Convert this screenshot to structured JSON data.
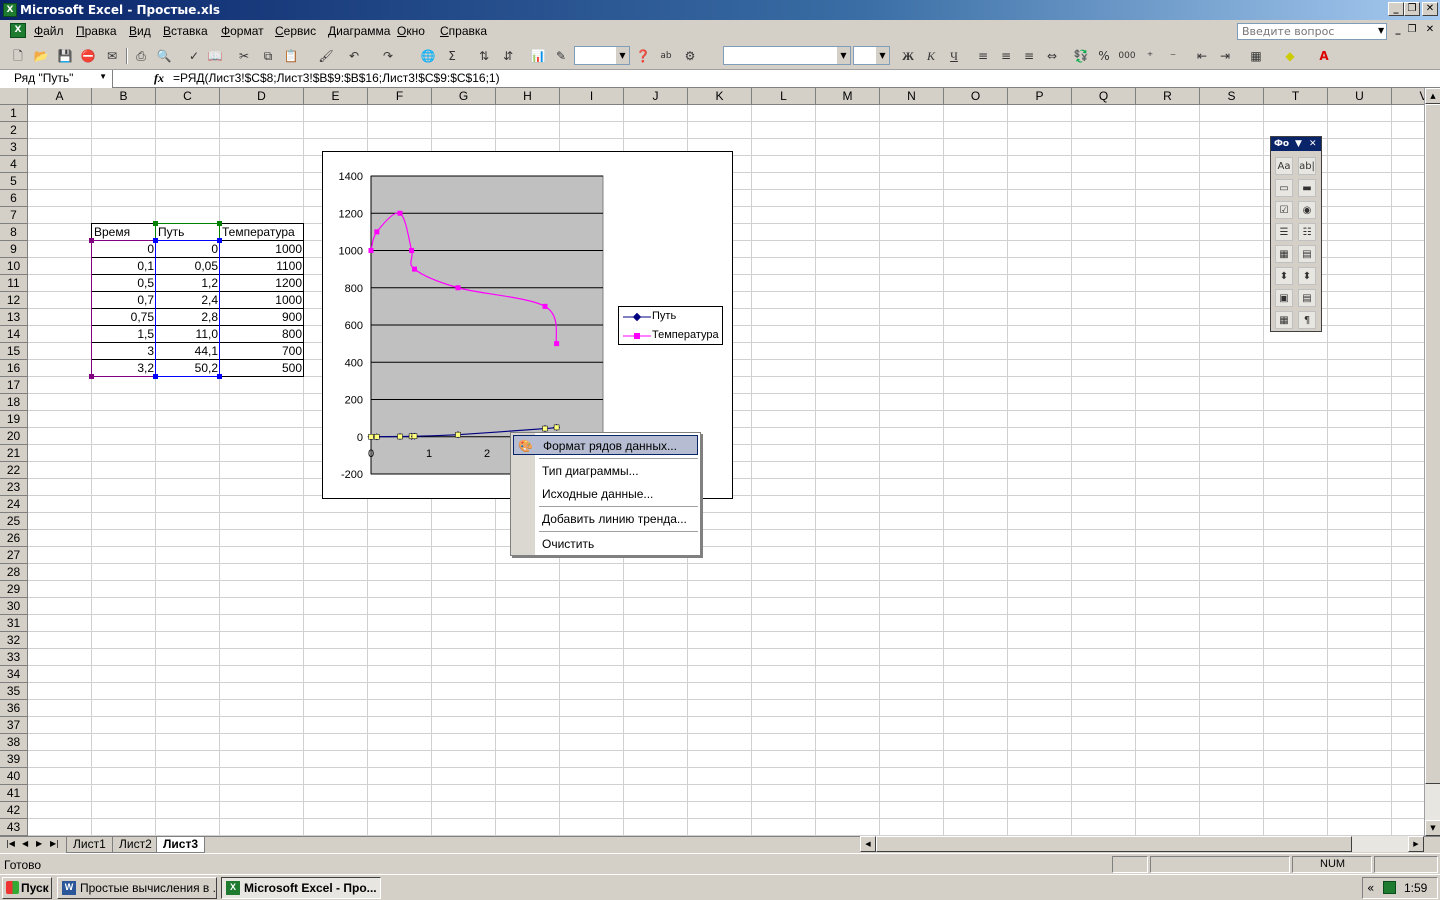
{
  "window": {
    "title": "Microsoft Excel - Простые.xls",
    "app_icon": "excel-icon",
    "controls": [
      "_",
      "❐",
      "✕"
    ],
    "doc_controls": [
      "_",
      "❐",
      "✕"
    ]
  },
  "menu": [
    "Файл",
    "Правка",
    "Вид",
    "Вставка",
    "Формат",
    "Сервис",
    "Диаграмма",
    "Окно",
    "Справка"
  ],
  "ask": {
    "placeholder": "Введите вопрос"
  },
  "formula_bar": {
    "name_box": "Ряд \"Путь\"",
    "fx": "fx",
    "formula": "=РЯД(Лист3!$C$8;Лист3!$B$9:$B$16;Лист3!$C$9:$C$16;1)"
  },
  "toolbar": {
    "fmt_bold": "Ж",
    "fmt_italic": "К",
    "fmt_underline": "Ч",
    "percent": "%",
    "thousands": "000"
  },
  "columns": [
    "A",
    "B",
    "C",
    "D",
    "E",
    "F",
    "G",
    "H",
    "I",
    "J",
    "K",
    "L",
    "M",
    "N",
    "O",
    "P",
    "Q",
    "R",
    "S",
    "T",
    "U",
    "V"
  ],
  "rows": [
    "1",
    "2",
    "3",
    "4",
    "5",
    "6",
    "7",
    "8",
    "9",
    "10",
    "11",
    "12",
    "13",
    "14",
    "15",
    "16",
    "17",
    "18",
    "19",
    "20",
    "21",
    "22",
    "23",
    "24",
    "25",
    "26",
    "27",
    "28",
    "29",
    "30",
    "31",
    "32",
    "33",
    "34",
    "35",
    "36",
    "37",
    "38",
    "39",
    "40",
    "41",
    "42",
    "43"
  ],
  "table": {
    "headers": [
      "Время",
      "Путь",
      "Температура"
    ],
    "rows": [
      [
        "0",
        "0",
        "1000"
      ],
      [
        "0,1",
        "0,05",
        "1100"
      ],
      [
        "0,5",
        "1,2",
        "1200"
      ],
      [
        "0,7",
        "2,4",
        "1000"
      ],
      [
        "0,75",
        "2,8",
        "900"
      ],
      [
        "1,5",
        "11,0",
        "800"
      ],
      [
        "3",
        "44,1",
        "700"
      ],
      [
        "3,2",
        "50,2",
        "500"
      ]
    ]
  },
  "chart_data": {
    "type": "scatter",
    "x": [
      0,
      0.1,
      0.5,
      0.7,
      0.75,
      1.5,
      3,
      3.2
    ],
    "series": [
      {
        "name": "Путь",
        "values": [
          0,
          0.05,
          1.2,
          2.4,
          2.8,
          11.0,
          44.1,
          50.2
        ],
        "color": "#000080",
        "marker": "diamond"
      },
      {
        "name": "Температура",
        "values": [
          1000,
          1100,
          1200,
          1000,
          900,
          800,
          700,
          500
        ],
        "color": "#ff00ff",
        "marker": "square"
      }
    ],
    "y_ticks": [
      "1400",
      "1200",
      "1000",
      "800",
      "600",
      "400",
      "200",
      "0",
      "-200"
    ],
    "x_ticks": [
      "0",
      "1",
      "2"
    ],
    "ylim": [
      -200,
      1400
    ],
    "xlim": [
      0,
      4
    ],
    "plot_background": "#c0c0c0",
    "grid": true,
    "smooth": true,
    "legend": "right",
    "selected_series": "Путь"
  },
  "context_menu": [
    {
      "label": "Формат рядов данных...",
      "highlight": true,
      "icon": "format-series-icon"
    },
    {
      "label": "Тип диаграммы..."
    },
    {
      "label": "Исходные данные..."
    },
    {
      "label": "Добавить линию тренда..."
    },
    {
      "label": "Очистить"
    }
  ],
  "forms_panel": {
    "title": "Фо",
    "buttons": [
      "Aa",
      "ab|",
      "▭",
      "▬",
      "☑",
      "◉",
      "☰",
      "☷",
      "▦",
      "▤",
      "⬍",
      "⬍",
      "▣",
      "▤",
      "▦",
      "¶"
    ]
  },
  "sheets": [
    "Лист1",
    "Лист2",
    "Лист3"
  ],
  "active_sheet": "Лист3",
  "status": {
    "ready": "Готово",
    "num": "NUM"
  },
  "taskbar": {
    "start": "Пуск",
    "items": [
      "Простые вычисления в ...",
      "Microsoft Excel - Про..."
    ],
    "clock": "1:59",
    "tray": "«"
  }
}
